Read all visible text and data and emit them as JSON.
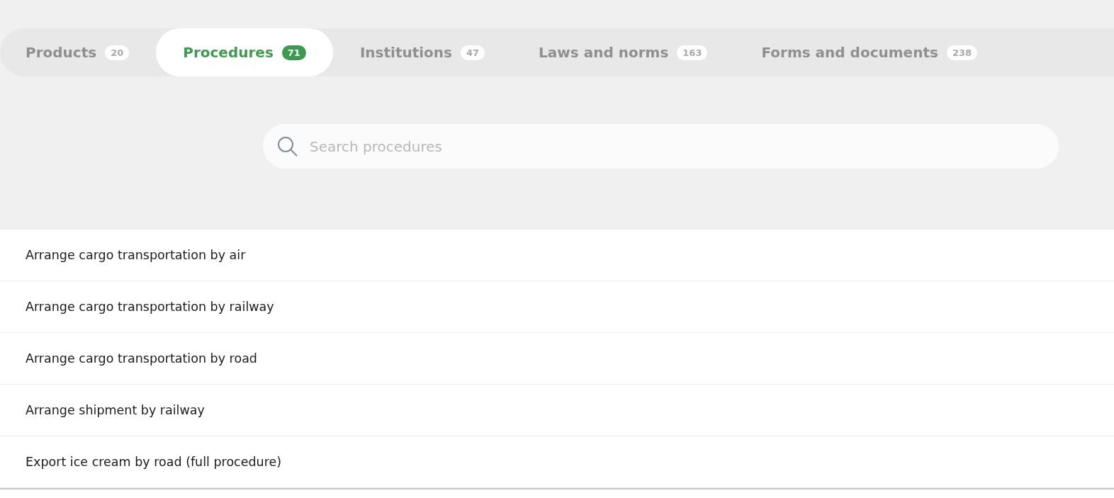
{
  "tabs": [
    {
      "label": "Products",
      "count": "20",
      "selected": false
    },
    {
      "label": "Procedures",
      "count": "71",
      "selected": true
    },
    {
      "label": "Institutions",
      "count": "47",
      "selected": false
    },
    {
      "label": "Laws and norms",
      "count": "163",
      "selected": false
    },
    {
      "label": "Forms and documents",
      "count": "238",
      "selected": false
    }
  ],
  "search": {
    "placeholder": "Search procedures"
  },
  "results": [
    "Arrange cargo transportation by air",
    "Arrange cargo transportation by railway",
    "Arrange cargo transportation by road",
    "Arrange shipment by railway",
    "Export ice cream by road (full procedure)"
  ]
}
